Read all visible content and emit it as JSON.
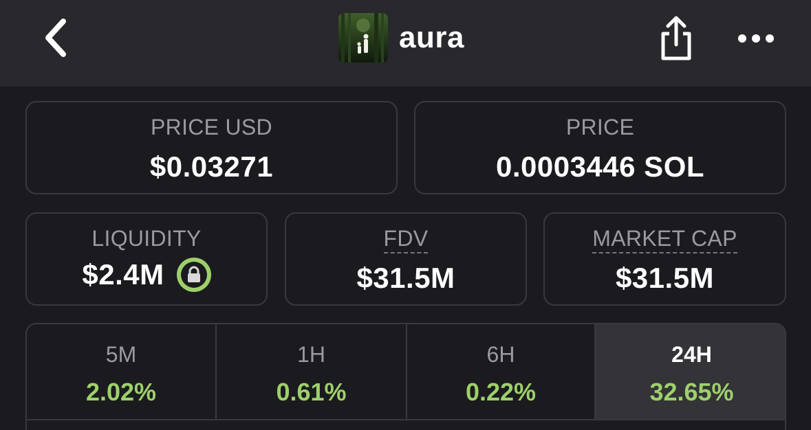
{
  "header": {
    "token_name": "aura",
    "avatar": "token-avatar-image"
  },
  "icons": {
    "back": "chevron-left-icon",
    "share": "share-icon",
    "more": "more-dots-icon",
    "lock": "lock-icon"
  },
  "colors": {
    "background": "#1b1b1f",
    "header": "#28282d",
    "border": "#38383e",
    "label": "#9a9aa2",
    "positive": "#9ed06a",
    "active_tab": "#333338"
  },
  "stats": {
    "price_usd": {
      "label": "PRICE USD",
      "value": "$0.03271"
    },
    "price_sol": {
      "label": "PRICE",
      "value": "0.0003446 SOL"
    },
    "liquidity": {
      "label": "LIQUIDITY",
      "value": "$2.4M",
      "locked": true
    },
    "fdv": {
      "label": "FDV",
      "value": "$31.5M"
    },
    "market_cap": {
      "label": "MARKET CAP",
      "value": "$31.5M"
    }
  },
  "timeframes": [
    {
      "label": "5M",
      "change": "2.02%",
      "active": false
    },
    {
      "label": "1H",
      "change": "0.61%",
      "active": false
    },
    {
      "label": "6H",
      "change": "0.22%",
      "active": false
    },
    {
      "label": "24H",
      "change": "32.65%",
      "active": true
    }
  ]
}
